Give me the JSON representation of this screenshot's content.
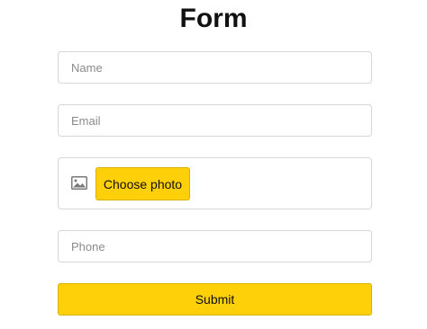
{
  "form": {
    "title": "Form",
    "fields": {
      "name": {
        "placeholder": "Name",
        "value": ""
      },
      "email": {
        "placeholder": "Email",
        "value": ""
      },
      "phone": {
        "placeholder": "Phone",
        "value": ""
      }
    },
    "photo": {
      "icon": "image-icon",
      "button_label": "Choose photo"
    },
    "submit_label": "Submit"
  },
  "colors": {
    "accent": "#fdd00a",
    "border": "#d6d6d6",
    "text": "#111111",
    "placeholder": "#8a8a8a"
  }
}
